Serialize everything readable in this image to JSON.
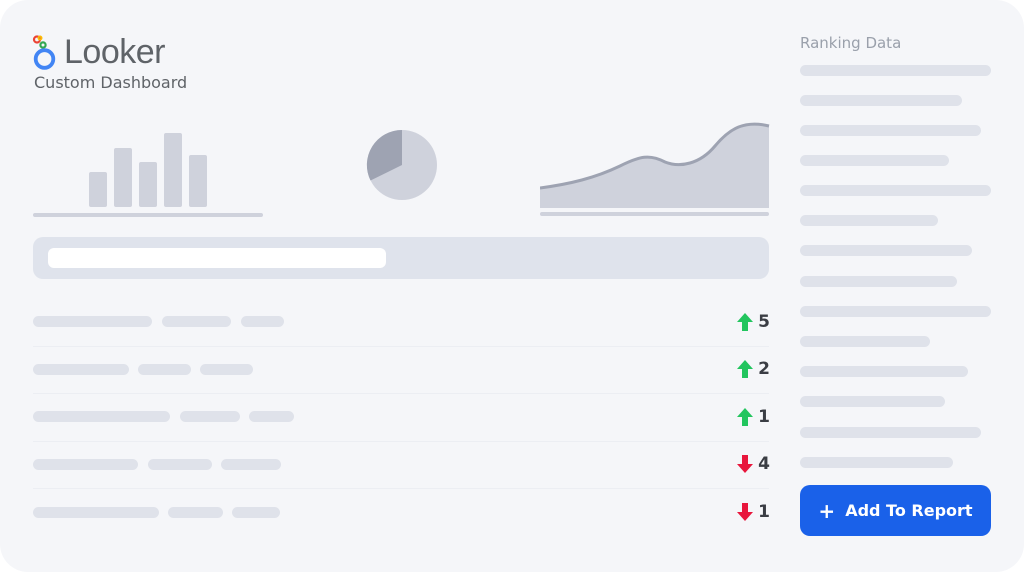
{
  "brand": {
    "name": "Looker",
    "subtitle": "Custom Dashboard",
    "logo_icon": "looker-logo-icon",
    "colors": {
      "red": "#ea4335",
      "yellow": "#fbbc04",
      "green": "#34a853",
      "blue": "#4285f4"
    }
  },
  "charts": {
    "bar": {
      "icon": "bar-chart-placeholder",
      "relative_heights": [
        0.48,
        0.8,
        0.61,
        1.0,
        0.7
      ]
    },
    "pie": {
      "icon": "pie-chart-placeholder",
      "dark_slice_fraction": 0.33
    },
    "area": {
      "icon": "area-chart-placeholder"
    }
  },
  "ranking": {
    "rows": [
      {
        "direction": "up",
        "value": "5"
      },
      {
        "direction": "up",
        "value": "2"
      },
      {
        "direction": "up",
        "value": "1"
      },
      {
        "direction": "down",
        "value": "4"
      },
      {
        "direction": "down",
        "value": "1"
      }
    ]
  },
  "sidebar": {
    "title": "Ranking Data"
  },
  "actions": {
    "add_to_report_label": "Add To Report",
    "add_to_report_icon": "plus-icon"
  },
  "colors": {
    "accent": "#1a61e9",
    "up_arrow": "#22c55e",
    "down_arrow": "#e8163c",
    "placeholder": "#dfe2ea",
    "chart_fill": "#cfd2dc"
  }
}
